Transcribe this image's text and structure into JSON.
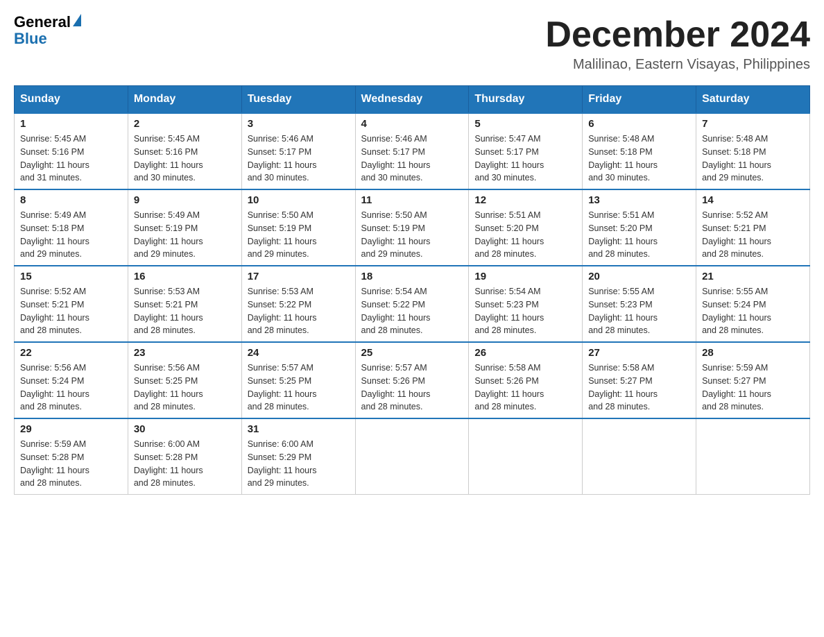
{
  "header": {
    "logo_general": "General",
    "logo_blue": "Blue",
    "month_title": "December 2024",
    "location": "Malilinao, Eastern Visayas, Philippines"
  },
  "weekdays": [
    "Sunday",
    "Monday",
    "Tuesday",
    "Wednesday",
    "Thursday",
    "Friday",
    "Saturday"
  ],
  "weeks": [
    [
      {
        "day": "1",
        "sunrise": "5:45 AM",
        "sunset": "5:16 PM",
        "daylight": "11 hours and 31 minutes."
      },
      {
        "day": "2",
        "sunrise": "5:45 AM",
        "sunset": "5:16 PM",
        "daylight": "11 hours and 30 minutes."
      },
      {
        "day": "3",
        "sunrise": "5:46 AM",
        "sunset": "5:17 PM",
        "daylight": "11 hours and 30 minutes."
      },
      {
        "day": "4",
        "sunrise": "5:46 AM",
        "sunset": "5:17 PM",
        "daylight": "11 hours and 30 minutes."
      },
      {
        "day": "5",
        "sunrise": "5:47 AM",
        "sunset": "5:17 PM",
        "daylight": "11 hours and 30 minutes."
      },
      {
        "day": "6",
        "sunrise": "5:48 AM",
        "sunset": "5:18 PM",
        "daylight": "11 hours and 30 minutes."
      },
      {
        "day": "7",
        "sunrise": "5:48 AM",
        "sunset": "5:18 PM",
        "daylight": "11 hours and 29 minutes."
      }
    ],
    [
      {
        "day": "8",
        "sunrise": "5:49 AM",
        "sunset": "5:18 PM",
        "daylight": "11 hours and 29 minutes."
      },
      {
        "day": "9",
        "sunrise": "5:49 AM",
        "sunset": "5:19 PM",
        "daylight": "11 hours and 29 minutes."
      },
      {
        "day": "10",
        "sunrise": "5:50 AM",
        "sunset": "5:19 PM",
        "daylight": "11 hours and 29 minutes."
      },
      {
        "day": "11",
        "sunrise": "5:50 AM",
        "sunset": "5:19 PM",
        "daylight": "11 hours and 29 minutes."
      },
      {
        "day": "12",
        "sunrise": "5:51 AM",
        "sunset": "5:20 PM",
        "daylight": "11 hours and 28 minutes."
      },
      {
        "day": "13",
        "sunrise": "5:51 AM",
        "sunset": "5:20 PM",
        "daylight": "11 hours and 28 minutes."
      },
      {
        "day": "14",
        "sunrise": "5:52 AM",
        "sunset": "5:21 PM",
        "daylight": "11 hours and 28 minutes."
      }
    ],
    [
      {
        "day": "15",
        "sunrise": "5:52 AM",
        "sunset": "5:21 PM",
        "daylight": "11 hours and 28 minutes."
      },
      {
        "day": "16",
        "sunrise": "5:53 AM",
        "sunset": "5:21 PM",
        "daylight": "11 hours and 28 minutes."
      },
      {
        "day": "17",
        "sunrise": "5:53 AM",
        "sunset": "5:22 PM",
        "daylight": "11 hours and 28 minutes."
      },
      {
        "day": "18",
        "sunrise": "5:54 AM",
        "sunset": "5:22 PM",
        "daylight": "11 hours and 28 minutes."
      },
      {
        "day": "19",
        "sunrise": "5:54 AM",
        "sunset": "5:23 PM",
        "daylight": "11 hours and 28 minutes."
      },
      {
        "day": "20",
        "sunrise": "5:55 AM",
        "sunset": "5:23 PM",
        "daylight": "11 hours and 28 minutes."
      },
      {
        "day": "21",
        "sunrise": "5:55 AM",
        "sunset": "5:24 PM",
        "daylight": "11 hours and 28 minutes."
      }
    ],
    [
      {
        "day": "22",
        "sunrise": "5:56 AM",
        "sunset": "5:24 PM",
        "daylight": "11 hours and 28 minutes."
      },
      {
        "day": "23",
        "sunrise": "5:56 AM",
        "sunset": "5:25 PM",
        "daylight": "11 hours and 28 minutes."
      },
      {
        "day": "24",
        "sunrise": "5:57 AM",
        "sunset": "5:25 PM",
        "daylight": "11 hours and 28 minutes."
      },
      {
        "day": "25",
        "sunrise": "5:57 AM",
        "sunset": "5:26 PM",
        "daylight": "11 hours and 28 minutes."
      },
      {
        "day": "26",
        "sunrise": "5:58 AM",
        "sunset": "5:26 PM",
        "daylight": "11 hours and 28 minutes."
      },
      {
        "day": "27",
        "sunrise": "5:58 AM",
        "sunset": "5:27 PM",
        "daylight": "11 hours and 28 minutes."
      },
      {
        "day": "28",
        "sunrise": "5:59 AM",
        "sunset": "5:27 PM",
        "daylight": "11 hours and 28 minutes."
      }
    ],
    [
      {
        "day": "29",
        "sunrise": "5:59 AM",
        "sunset": "5:28 PM",
        "daylight": "11 hours and 28 minutes."
      },
      {
        "day": "30",
        "sunrise": "6:00 AM",
        "sunset": "5:28 PM",
        "daylight": "11 hours and 28 minutes."
      },
      {
        "day": "31",
        "sunrise": "6:00 AM",
        "sunset": "5:29 PM",
        "daylight": "11 hours and 29 minutes."
      },
      null,
      null,
      null,
      null
    ]
  ],
  "labels": {
    "sunrise": "Sunrise:",
    "sunset": "Sunset:",
    "daylight": "Daylight:"
  }
}
